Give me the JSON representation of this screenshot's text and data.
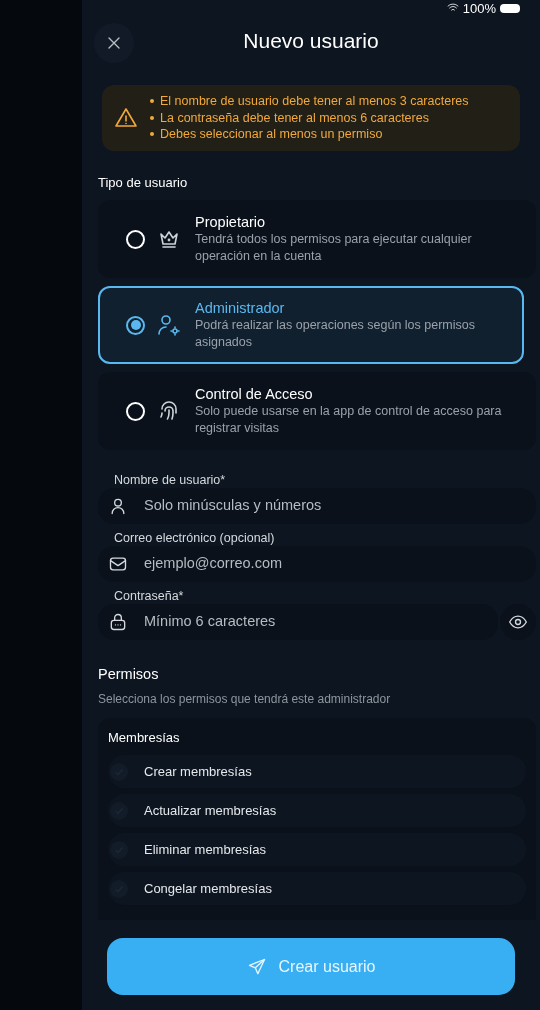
{
  "status_bar": {
    "battery": "100%"
  },
  "header": {
    "title": "Nuevo usuario"
  },
  "alert": {
    "messages": [
      "El nombre de usuario debe tener al menos 3 caracteres",
      "La contraseña debe tener al menos 6 caracteres",
      "Debes seleccionar al menos un permiso"
    ]
  },
  "user_type": {
    "label": "Tipo de usuario",
    "options": [
      {
        "kind": "crown",
        "title": "Propietario",
        "description": "Tendrá todos los permisos para ejecutar cualquier operación en la cuenta",
        "selected": false
      },
      {
        "kind": "admin",
        "title": "Administrador",
        "description": "Podrá realizar las operaciones según los permisos asignados",
        "selected": true
      },
      {
        "kind": "fingerprint",
        "title": "Control de Acceso",
        "description": "Solo puede usarse en la app de control de acceso para registrar visitas",
        "selected": false
      }
    ]
  },
  "fields": [
    {
      "kind": "user",
      "label": "Nombre de usuario*",
      "placeholder": "Solo minúsculas y números"
    },
    {
      "kind": "mail",
      "label": "Correo electrónico (opcional)",
      "placeholder": "ejemplo@correo.com"
    },
    {
      "kind": "password",
      "label": "Contraseña*",
      "placeholder": "Mínimo 6 caracteres"
    }
  ],
  "permissions": {
    "title": "Permisos",
    "subtitle": "Selecciona los permisos que tendrá este administrador",
    "groups": [
      {
        "title": "Membresías",
        "items": [
          {
            "label": "Crear membresías",
            "checked": false
          },
          {
            "label": "Actualizar membresías",
            "checked": false
          },
          {
            "label": "Eliminar membresías",
            "checked": false
          },
          {
            "label": "Congelar membresías",
            "checked": false
          }
        ]
      }
    ]
  },
  "submit": {
    "label": "Crear usuario"
  }
}
